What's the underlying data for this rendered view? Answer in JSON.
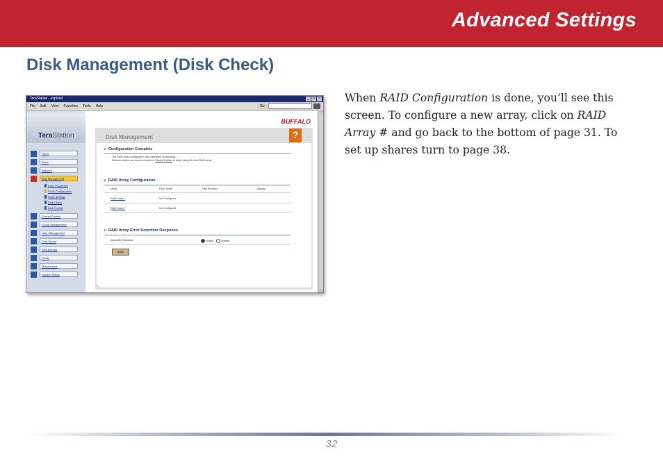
{
  "header": {
    "title": "Advanced Settings",
    "bg_color": "#c1232f"
  },
  "section_heading": "Disk Management (Disk Check)",
  "body": {
    "t1": "When ",
    "i1": "RAID Configuration",
    "t2": " is done, you’ll see this screen.  To configure a new array, click on ",
    "i2": "RAID Array #",
    "t3": " and go back to the bottom of page 31.  To set up shares turn to page 38."
  },
  "footer": {
    "page_number": "32"
  },
  "screenshot": {
    "window_title": "TeraStation - explorer",
    "window_buttons": [
      "_",
      "□",
      "×"
    ],
    "menu": [
      "File",
      "Edit",
      "View",
      "Favorites",
      "Tools",
      "Help"
    ],
    "go_button": "Go",
    "logo_a": "Tera",
    "logo_b": "Station",
    "brand": "BUFFALO",
    "help_icon": "question-mark-icon",
    "sidebar": [
      {
        "label": "Home",
        "active": false
      },
      {
        "label": "Basic",
        "active": false
      },
      {
        "label": "Network",
        "active": false
      },
      {
        "label": "Disk Management",
        "active": true
      },
      {
        "label": "Shared Folders",
        "active": false
      },
      {
        "label": "Group Management",
        "active": false
      },
      {
        "label": "User Management",
        "active": false
      },
      {
        "label": "Print Server",
        "active": false
      },
      {
        "label": "Disk Backup",
        "active": false
      },
      {
        "label": "PCast",
        "active": false
      },
      {
        "label": "Maintenance",
        "active": false
      },
      {
        "label": "System Status",
        "active": false
      }
    ],
    "subitems": [
      "Drive Properties",
      "RAID Configuration",
      "RAID Settings",
      "Disk Check",
      "Disk Format"
    ],
    "panel_title": "Disk Management",
    "config_complete_title": "Configuration Complete",
    "config_complete_line1": "The RAID Array configuration has completed successfully.",
    "config_complete_line2a": "Network shares can now be created at ",
    "config_complete_link": "Shared Folders",
    "config_complete_line2b": " to begin using this new RAID Array.",
    "raid_title": "RAID Array Configuration",
    "raid_headers": [
      "Name",
      "RAID Mode",
      "Disk Structure",
      "Capacity"
    ],
    "raid_rows": [
      {
        "name": "RAID Array 1",
        "mode": "Not Configured"
      },
      {
        "name": "RAID Array 2",
        "mode": "Not Configured"
      }
    ],
    "error_title": "RAID Array Error Detection Response",
    "auto_shutdown_label": "Automatic Shutdown",
    "enable_label": "Enable",
    "disable_label": "Disable",
    "apply_label": "Apply"
  }
}
